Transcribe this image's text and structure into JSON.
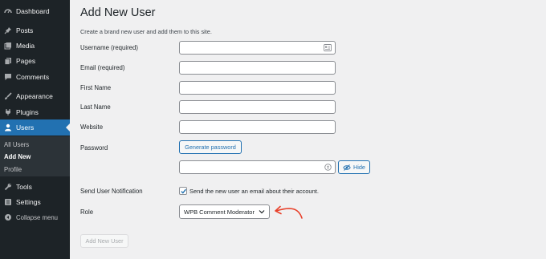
{
  "sidebar": {
    "items": [
      {
        "label": "Dashboard",
        "icon": "dashboard-icon"
      },
      {
        "label": "Posts",
        "icon": "pin-icon"
      },
      {
        "label": "Media",
        "icon": "media-icon"
      },
      {
        "label": "Pages",
        "icon": "pages-icon"
      },
      {
        "label": "Comments",
        "icon": "comment-icon"
      },
      {
        "label": "Appearance",
        "icon": "brush-icon"
      },
      {
        "label": "Plugins",
        "icon": "plug-icon"
      },
      {
        "label": "Users",
        "icon": "user-icon",
        "current": true
      },
      {
        "label": "Tools",
        "icon": "wrench-icon"
      },
      {
        "label": "Settings",
        "icon": "settings-icon"
      },
      {
        "label": "Collapse menu",
        "icon": "collapse-icon"
      }
    ],
    "submenu": [
      {
        "label": "All Users"
      },
      {
        "label": "Add New",
        "active": true
      },
      {
        "label": "Profile"
      }
    ]
  },
  "main": {
    "title": "Add New User",
    "description": "Create a brand new user and add them to this site.",
    "fields": {
      "username_label": "Username (required)",
      "email_label": "Email (required)",
      "first_name_label": "First Name",
      "last_name_label": "Last Name",
      "website_label": "Website",
      "password_label": "Password",
      "generate_password_button": "Generate password",
      "hide_button": "Hide",
      "notification_label": "Send User Notification",
      "notification_text": "Send the new user an email about their account.",
      "notification_checked": true,
      "role_label": "Role",
      "role_value": "WPB Comment Moderator"
    },
    "submit_label": "Add New User",
    "colors": {
      "sidebar_bg": "#1d2327",
      "accent": "#2271b1",
      "annotation_arrow": "#e8402a"
    }
  }
}
